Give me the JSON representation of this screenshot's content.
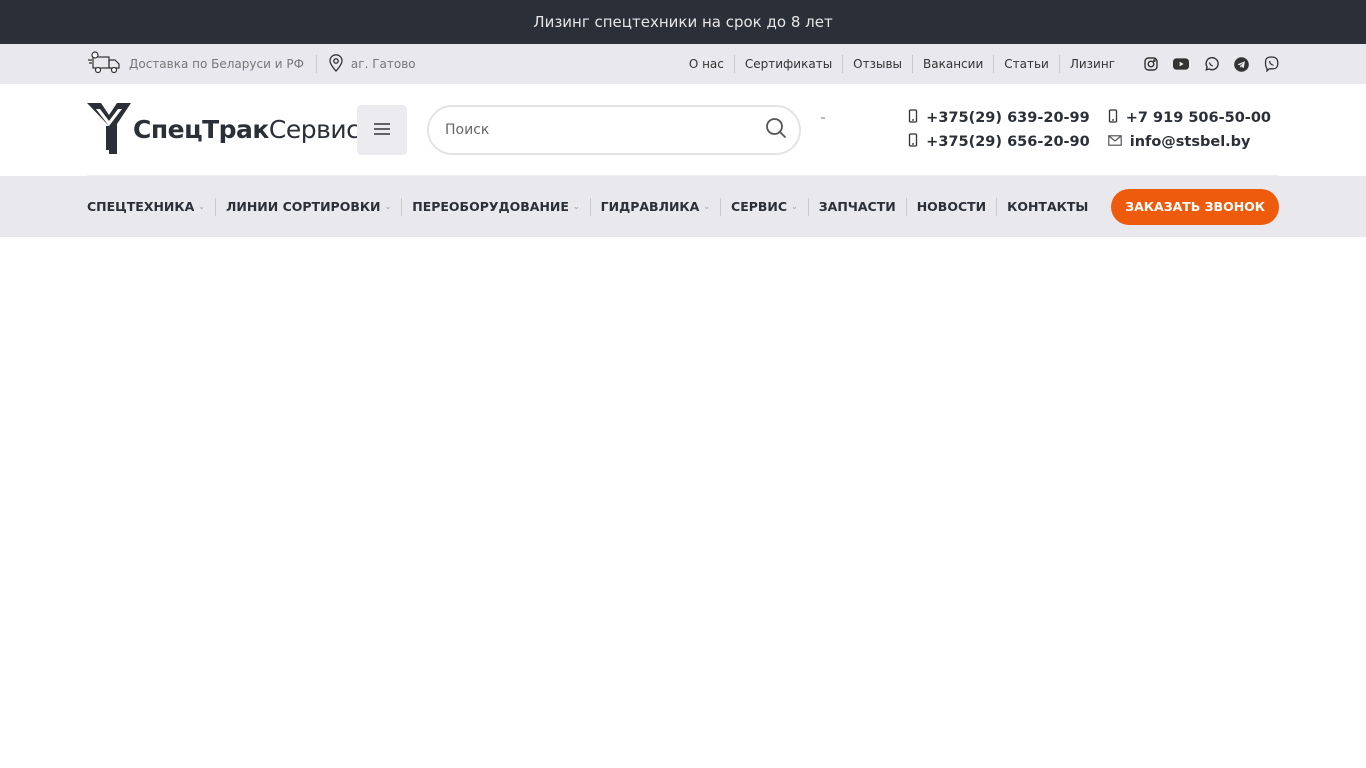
{
  "promo": {
    "text": "Лизинг спецтехники на срок до 8 лет"
  },
  "infobar": {
    "delivery": "Доставка по Беларуси и РФ",
    "location": "аг. Гатово",
    "links": [
      "О нас",
      "Сертификаты",
      "Отзывы",
      "Вакансии",
      "Статьи",
      "Лизинг"
    ],
    "socials": [
      "instagram-icon",
      "youtube-icon",
      "whatsapp-icon",
      "telegram-icon",
      "viber-icon"
    ]
  },
  "header": {
    "logo_bold": "СпецТрак",
    "logo_light": "Сервис",
    "search_placeholder": "Поиск",
    "phones": [
      "+375(29) 639-20-99",
      "+7 919 506-50-00",
      "+375(29) 656-20-90"
    ],
    "email": "info@stsbel.by"
  },
  "nav": {
    "items": [
      "СПЕЦТЕХНИКА",
      "ЛИНИИ СОРТИРОВКИ",
      "ПЕРЕОБОРУДОВАНИЕ",
      "ГИДРАВЛИКА",
      "СЕРВИС",
      "ЗАПЧАСТИ",
      "НОВОСТИ",
      "КОНТАКТЫ"
    ],
    "cta": "ЗАКАЗАТЬ ЗВОНОК"
  },
  "colors": {
    "accent": "#ef5b0c",
    "dark": "#2b2f38",
    "light_bg": "#e9e8ec"
  }
}
